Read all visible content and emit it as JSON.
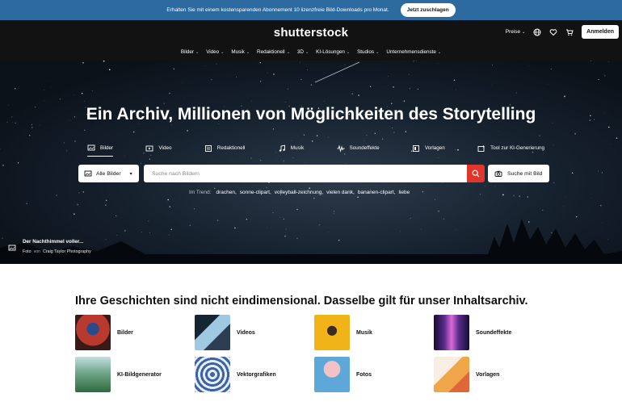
{
  "promo": {
    "text": "Erhalten Sie mit einem kostensparenden Abonnement 10 lizenzfreie Bild-Downloads pro Monat.",
    "button": "Jetzt zuschlagen"
  },
  "header": {
    "logo": "shutterstock",
    "pricing": "Preise",
    "signin": "Anmelden",
    "nav": [
      "Bilder",
      "Video",
      "Musik",
      "Redaktionell",
      "3D",
      "KI-Lösungen",
      "Studios",
      "Unternehmensdienste"
    ]
  },
  "hero": {
    "title": "Ein Archiv, Millionen von Möglichkeiten des Storytelling",
    "tabs": [
      "Bilder",
      "Video",
      "Redaktionell",
      "Musik",
      "Soundeffekte",
      "Vorlagen",
      "Tool zur KI-Generierung"
    ],
    "search": {
      "type": "Alle Bilder",
      "placeholder": "Suche nach Bildern",
      "image_search": "Suche mit Bild"
    },
    "trending_label": "Im Trend:",
    "trending": [
      "drachen,",
      "sonne-clipart,",
      "volleyball-zeichnung,",
      "vielen dank,",
      "bananen-clipart,",
      "liebe"
    ],
    "credit": {
      "title": "Der Nachthimmel voller...",
      "type": "Foto",
      "by": "von",
      "author": "Craig Taylor Photography"
    }
  },
  "section": {
    "heading": "Ihre Geschichten sind nicht eindimensional. Dasselbe gilt für unser Inhaltsarchiv.",
    "categories": [
      {
        "label": "Bilder",
        "color": "#b83a2e"
      },
      {
        "label": "Videos",
        "color": "#2b3e52"
      },
      {
        "label": "Musik",
        "color": "#f0b418"
      },
      {
        "label": "Soundeffekte",
        "color": "#5a2b8c"
      },
      {
        "label": "KI-Bildgenerator",
        "color": "#4f8a5e"
      },
      {
        "label": "Vektorgrafiken",
        "color": "#3c63a8"
      },
      {
        "label": "Fotos",
        "color": "#5ea8d9"
      },
      {
        "label": "Vorlagen",
        "color": "#f2a64a"
      }
    ]
  }
}
